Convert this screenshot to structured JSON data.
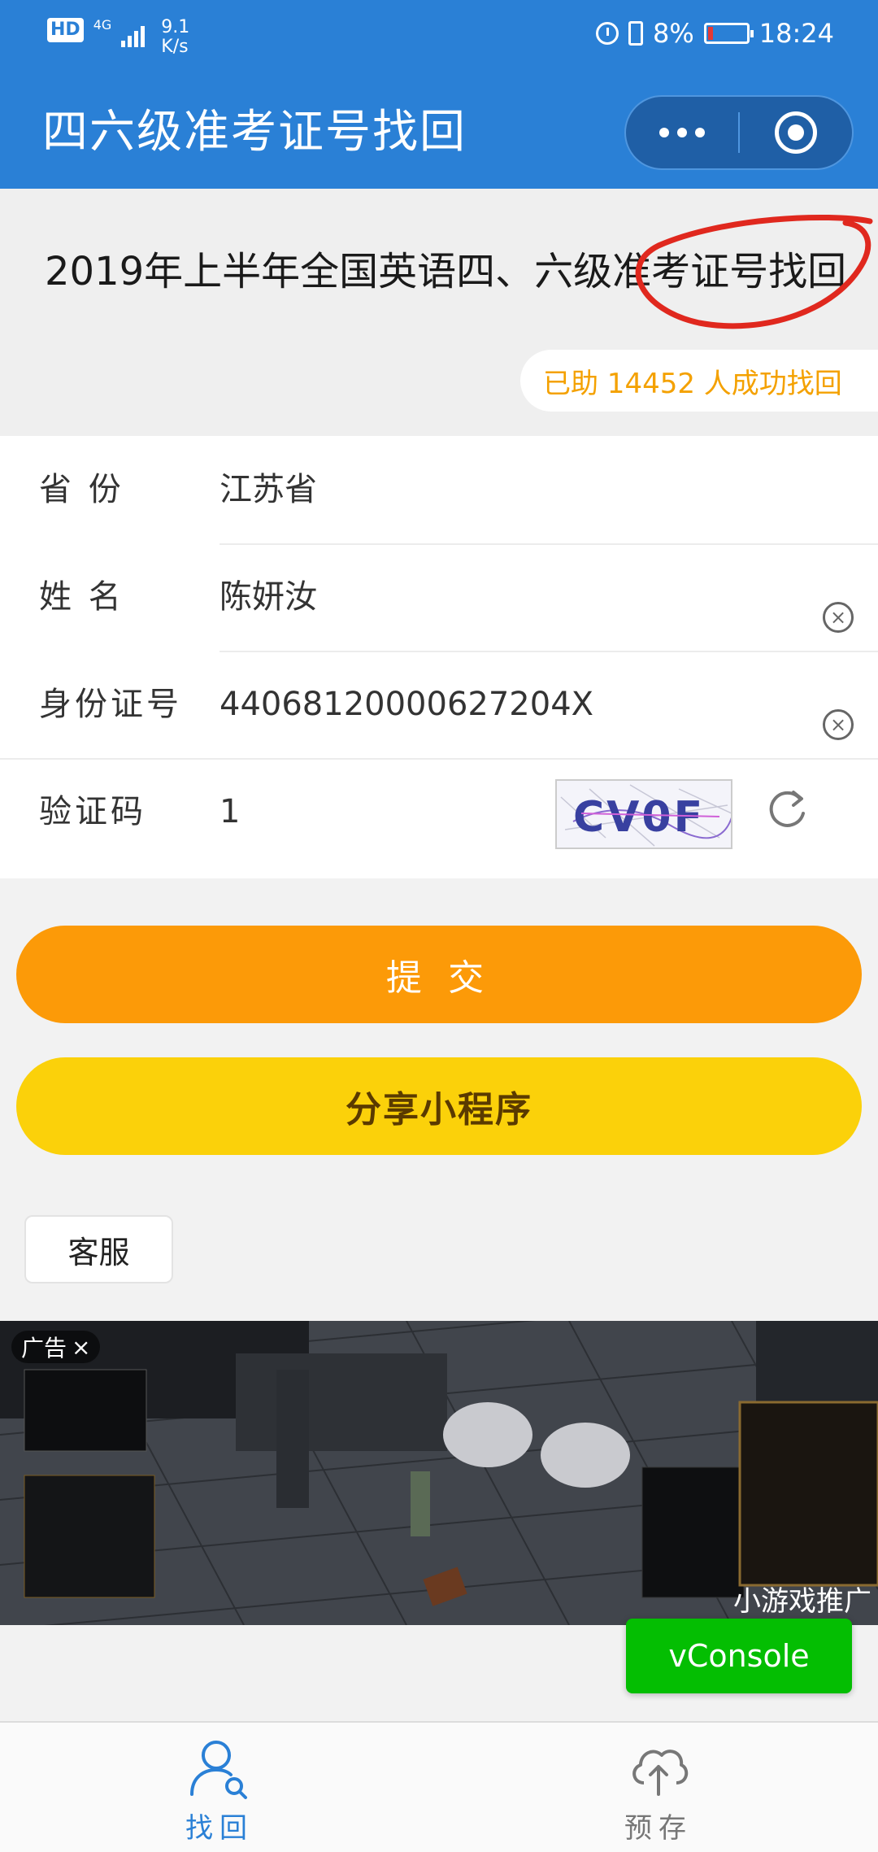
{
  "status_bar": {
    "hd": "HD",
    "network": "4G",
    "speed_value": "9.1",
    "speed_unit": "K/s",
    "battery": "8%",
    "time": "18:24"
  },
  "nav": {
    "title": "四六级准考证号找回"
  },
  "headline": {
    "title": "2019年上半年全国英语四、六级准考证号找回",
    "success_text": "已助 14452 人成功找回"
  },
  "form": {
    "province": {
      "label": "省 份",
      "value": "江苏省"
    },
    "name": {
      "label": "姓 名",
      "value": "陈妍汝"
    },
    "id_number": {
      "label": "身份证号",
      "value": "44068120000627204X"
    },
    "captcha": {
      "label": "验证码",
      "value": "1",
      "image_text": "CV0F"
    }
  },
  "buttons": {
    "submit": "提 交",
    "share": "分享小程序",
    "service": "客服"
  },
  "ad": {
    "label": "广告",
    "close": "×",
    "promo": "小游戏推广"
  },
  "vconsole": "vConsole",
  "tabs": [
    {
      "label": "找回",
      "icon": "user-search-icon",
      "active": true
    },
    {
      "label": "预存",
      "icon": "cloud-upload-icon",
      "active": false
    }
  ],
  "colors": {
    "primary": "#2a80d6",
    "submit": "#fc9a08",
    "share": "#fbd10a",
    "success_text": "#f4a100",
    "vconsole": "#04be02"
  }
}
